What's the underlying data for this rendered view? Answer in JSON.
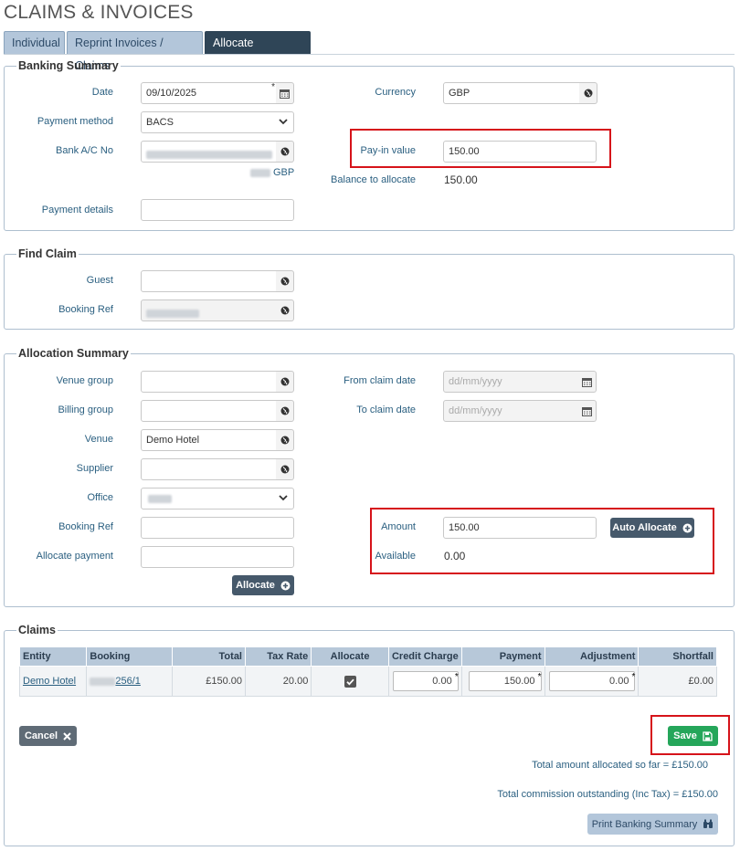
{
  "page": {
    "title": "CLAIMS & INVOICES"
  },
  "tabs": [
    {
      "label": "Individual"
    },
    {
      "label": "Reprint Invoices / Claims"
    },
    {
      "label": "Allocate Payments"
    }
  ],
  "banking": {
    "legend": "Banking Summary",
    "date_label": "Date",
    "date_value": "09/10/2025",
    "currency_label": "Currency",
    "currency_value": "GBP",
    "payment_method_label": "Payment method",
    "payment_method_value": "BACS",
    "bank_label": "Bank A/C No",
    "bank_currency": "GBP",
    "payin_label": "Pay-in value",
    "payin_value": "150.00",
    "balance_label": "Balance to allocate",
    "balance_value": "150.00",
    "details_label": "Payment details",
    "details_value": ""
  },
  "find": {
    "legend": "Find Claim",
    "guest_label": "Guest",
    "booking_ref_label": "Booking Ref"
  },
  "allocation": {
    "legend": "Allocation Summary",
    "venue_group_label": "Venue group",
    "billing_group_label": "Billing group",
    "venue_label": "Venue",
    "venue_value": "Demo Hotel",
    "supplier_label": "Supplier",
    "office_label": "Office",
    "booking_ref_label": "Booking Ref",
    "allocate_payment_label": "Allocate payment",
    "from_label": "From claim date",
    "from_placeholder": "dd/mm/yyyy",
    "to_label": "To claim date",
    "to_placeholder": "dd/mm/yyyy",
    "amount_label": "Amount",
    "amount_value": "150.00",
    "available_label": "Available",
    "available_value": "0.00",
    "auto_allocate_label": "Auto Allocate",
    "allocate_label": "Allocate"
  },
  "claims": {
    "legend": "Claims",
    "columns": [
      "Entity",
      "Booking",
      "Total",
      "Tax Rate",
      "Allocate",
      "Credit Charge",
      "Payment",
      "Adjustment",
      "Shortfall"
    ],
    "rows": [
      {
        "entity": "Demo Hotel",
        "booking": "256/1",
        "total": "£150.00",
        "tax_rate": "20.00",
        "allocate": true,
        "credit_charge": "0.00",
        "payment": "150.00",
        "adjustment": "0.00",
        "shortfall": "£0.00"
      }
    ],
    "cancel_label": "Cancel",
    "save_label": "Save",
    "total_allocated": "Total amount allocated so far = £150.00",
    "total_commission": "Total commission outstanding (Inc Tax) = £150.00",
    "print_label": "Print Banking Summary"
  },
  "colors": {
    "accent_dark": "#2f4557",
    "save_green": "#25a65a",
    "highlight_red": "#d6131a"
  }
}
